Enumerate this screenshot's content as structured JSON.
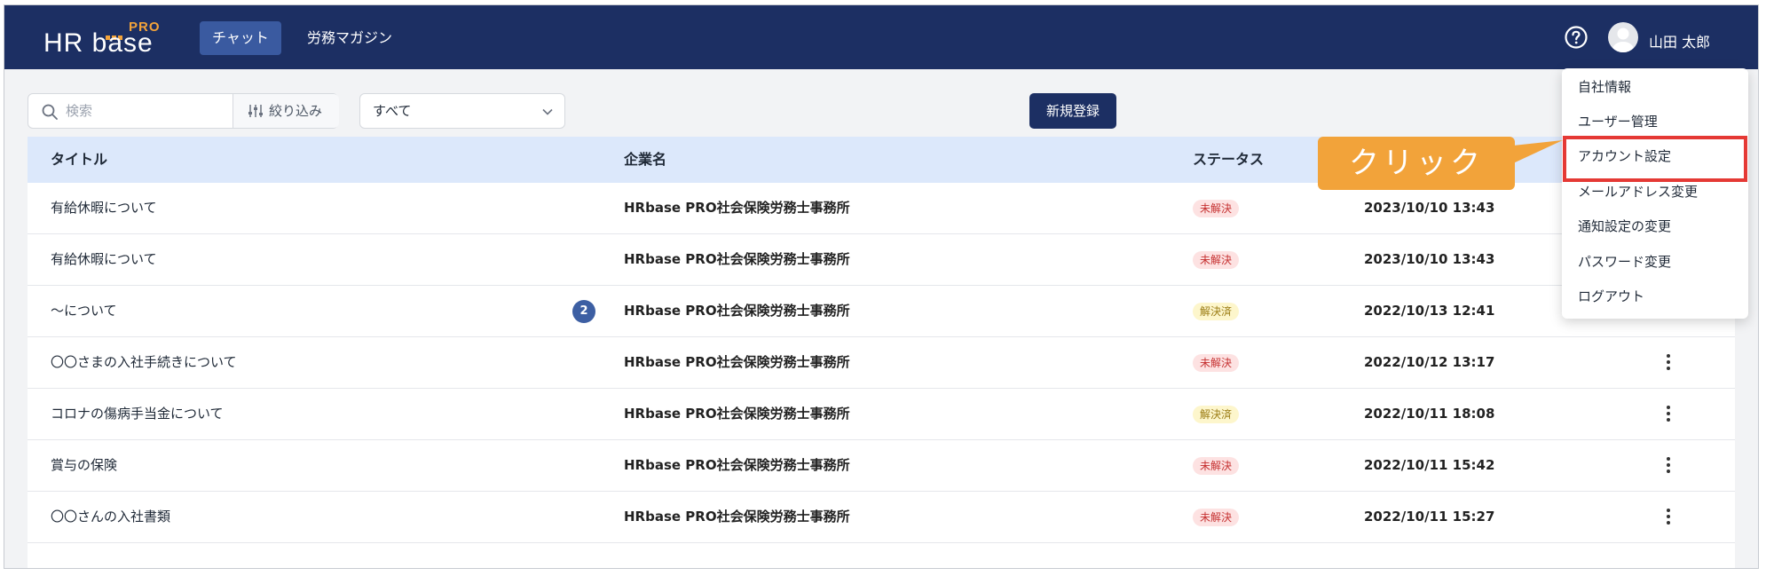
{
  "header": {
    "logo_main": "HR base",
    "logo_sup": "PRO",
    "nav": [
      {
        "label": "チャット"
      },
      {
        "label": "労務マガジン"
      }
    ],
    "user_name": "山田 太郎"
  },
  "toolbar": {
    "search_placeholder": "検索",
    "filter_label": "絞り込み",
    "select_value": "すべて",
    "new_button": "新規登録"
  },
  "table": {
    "headers": {
      "title": "タイトル",
      "company": "企業名",
      "status": "ステータス"
    },
    "rows": [
      {
        "title": "有給休暇について",
        "company": "HRbase PRO社会保険労務士事務所",
        "status": "未解決",
        "date": "2023/10/10 13:43"
      },
      {
        "title": "有給休暇について",
        "company": "HRbase PRO社会保険労務士事務所",
        "status": "未解決",
        "date": "2023/10/10 13:43"
      },
      {
        "title": "〜について",
        "company": "HRbase PRO社会保険労務士事務所",
        "status": "解決済",
        "date": "2022/10/13 12:41",
        "count": "2"
      },
      {
        "title": "〇〇さまの入社手続きについて",
        "company": "HRbase PRO社会保険労務士事務所",
        "status": "未解決",
        "date": "2022/10/12 13:17"
      },
      {
        "title": "コロナの傷病手当金について",
        "company": "HRbase PRO社会保険労務士事務所",
        "status": "解決済",
        "date": "2022/10/11 18:08"
      },
      {
        "title": "賞与の保険",
        "company": "HRbase PRO社会保険労務士事務所",
        "status": "未解決",
        "date": "2022/10/11 15:42"
      },
      {
        "title": "〇〇さんの入社書類",
        "company": "HRbase PRO社会保険労務士事務所",
        "status": "未解決",
        "date": "2022/10/11 15:27"
      }
    ]
  },
  "menu": {
    "items": [
      {
        "label": "自社情報"
      },
      {
        "label": "ユーザー管理"
      },
      {
        "label": "アカウント設定"
      },
      {
        "label": "メールアドレス変更"
      },
      {
        "label": "通知設定の変更"
      },
      {
        "label": "パスワード変更"
      },
      {
        "label": "ログアウト"
      }
    ]
  },
  "callout": {
    "text": "クリック"
  },
  "colors": {
    "header_bg": "#1c2f63",
    "accent_orange": "#f2a33a",
    "highlight_red": "#e53935",
    "table_head_bg": "#dce8fb"
  }
}
